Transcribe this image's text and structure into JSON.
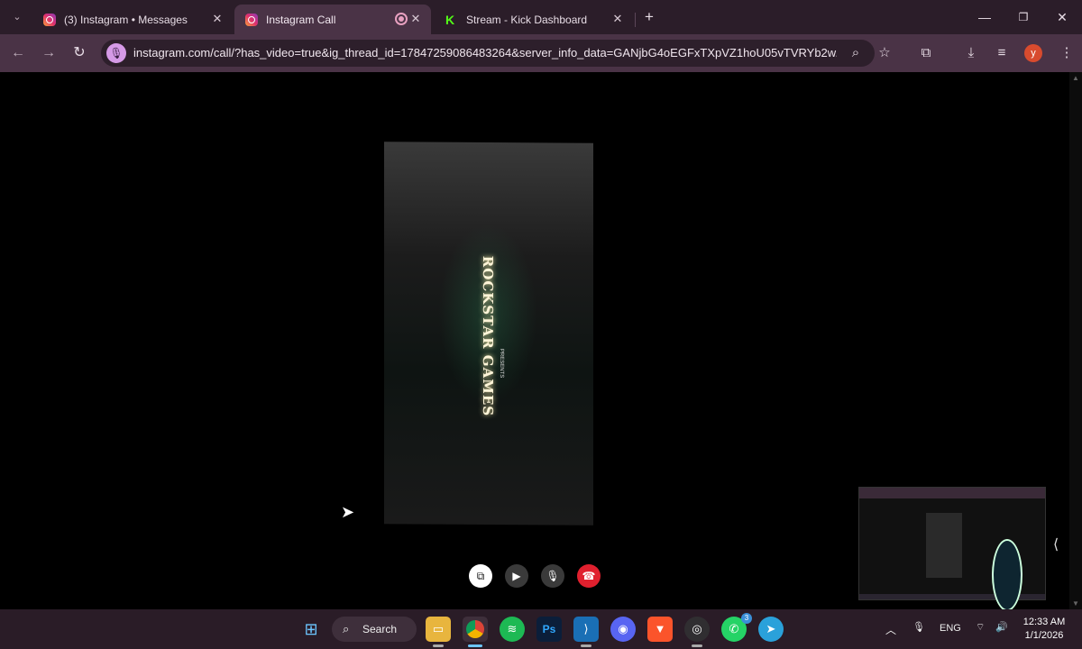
{
  "browser": {
    "tabs": [
      {
        "title": "(3) Instagram • Messages",
        "favicon": "instagram-icon",
        "active": false
      },
      {
        "title": "Instagram Call",
        "favicon": "instagram-icon",
        "active": true,
        "recording": true
      },
      {
        "title": "Stream - Kick Dashboard",
        "favicon": "kick-icon",
        "active": false
      }
    ],
    "url": "instagram.com/call/?has_video=true&ig_thread_id=17847259086483264&server_info_data=GANjbG4oEGFxTXpVZ1hoU05vTVRYb2w...",
    "profile_initial": "y",
    "colors": {
      "frame": "#2b1d29",
      "toolbar": "#4a3346",
      "accent": "#d59ae6"
    }
  },
  "call": {
    "remote_video_text": "ROCKSTAR GAMES",
    "remote_video_subtext": "PRESENTS",
    "controls": [
      "share-screen",
      "camera",
      "microphone",
      "end-call"
    ],
    "end_color": "#e0202e"
  },
  "taskbar": {
    "search_label": "Search",
    "apps": [
      "windows-start",
      "file-explorer",
      "chrome",
      "spotify",
      "photoshop",
      "vscode",
      "discord",
      "brave",
      "obs",
      "whatsapp",
      "telegram"
    ],
    "whatsapp_badge": "3",
    "language": "ENG",
    "time": "12:33 AM",
    "date": "1/1/2026"
  }
}
